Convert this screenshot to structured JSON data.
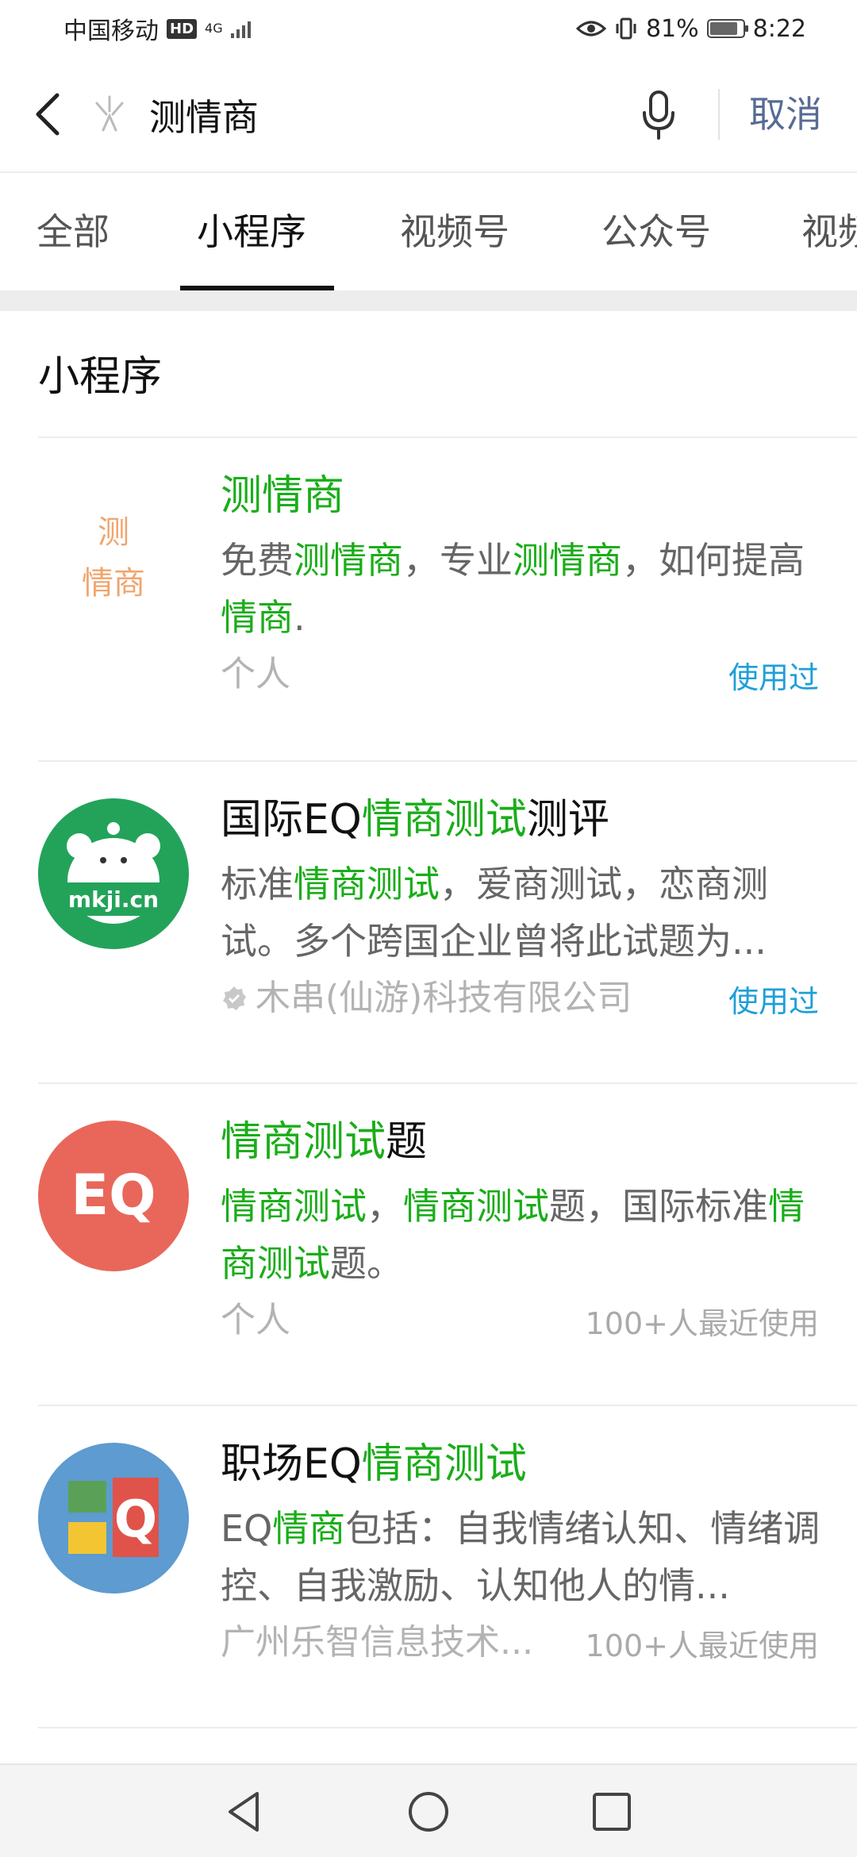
{
  "status_bar": {
    "carrier": "中国移动",
    "hd": "HD",
    "network": "4G",
    "battery": "81%",
    "time": "8:22"
  },
  "search": {
    "query": "测情商",
    "cancel_label": "取消"
  },
  "tabs": [
    {
      "label": "全部",
      "active": false
    },
    {
      "label": "小程序",
      "active": true
    },
    {
      "label": "视频号",
      "active": false
    },
    {
      "label": "公众号",
      "active": false
    },
    {
      "label": "视频",
      "active": false
    }
  ],
  "section": {
    "title": "小程序"
  },
  "results": [
    {
      "icon_name": "测情商",
      "icon_text": [
        "测",
        "情商"
      ],
      "title": [
        {
          "t": "测情商",
          "hl": true
        }
      ],
      "description": [
        {
          "t": "免费",
          "hl": false
        },
        {
          "t": "测情商",
          "hl": true
        },
        {
          "t": "，专业",
          "hl": false
        },
        {
          "t": "测情商",
          "hl": true
        },
        {
          "t": "，如何提高",
          "hl": false
        },
        {
          "t": "情商",
          "hl": true
        },
        {
          "t": ".",
          "hl": false
        }
      ],
      "owner": "个人",
      "owner_verified": false,
      "meta": "使用过",
      "meta_type": "used"
    },
    {
      "icon_name": "mkji-bear",
      "icon_text": [
        "mkji.cn"
      ],
      "title": [
        {
          "t": "国际EQ",
          "hl": false
        },
        {
          "t": "情商测试",
          "hl": true
        },
        {
          "t": "测评",
          "hl": false
        }
      ],
      "description": [
        {
          "t": "标准",
          "hl": false
        },
        {
          "t": "情商测试",
          "hl": true
        },
        {
          "t": "，爱商测试，恋商测试。多个跨国企业曾将此试题为...",
          "hl": false
        }
      ],
      "owner": "木串(仙游)科技有限公司",
      "owner_verified": true,
      "meta": "使用过",
      "meta_type": "used"
    },
    {
      "icon_name": "EQ",
      "icon_text": [
        "EQ"
      ],
      "title": [
        {
          "t": "情商测试",
          "hl": true
        },
        {
          "t": "题",
          "hl": false
        }
      ],
      "description": [
        {
          "t": "情商测试",
          "hl": true
        },
        {
          "t": "，",
          "hl": false
        },
        {
          "t": "情商测试",
          "hl": true
        },
        {
          "t": "题，国际标准",
          "hl": false
        },
        {
          "t": "情商测试",
          "hl": true
        },
        {
          "t": "题。",
          "hl": false
        }
      ],
      "owner": "个人",
      "owner_verified": false,
      "meta": "100+人最近使用",
      "meta_type": "recent"
    },
    {
      "icon_name": "EQ-blocks",
      "icon_text": [
        "Q"
      ],
      "title": [
        {
          "t": "职场EQ",
          "hl": false
        },
        {
          "t": "情商测试",
          "hl": true
        }
      ],
      "description": [
        {
          "t": "EQ",
          "hl": false
        },
        {
          "t": "情商",
          "hl": true
        },
        {
          "t": "包括：自我情绪认知、情绪调控、自我激励、认知他人的情...",
          "hl": false
        }
      ],
      "owner": "广州乐智信息技术...",
      "owner_verified": false,
      "meta": "100+人最近使用",
      "meta_type": "recent"
    }
  ],
  "colors": {
    "highlight": "#1aad19",
    "used": "#1e9fd8",
    "cancel": "#576b95",
    "eq_red": "#e8675a",
    "mkji_green": "#23a35a",
    "blocks_blue": "#5d9bd0"
  }
}
